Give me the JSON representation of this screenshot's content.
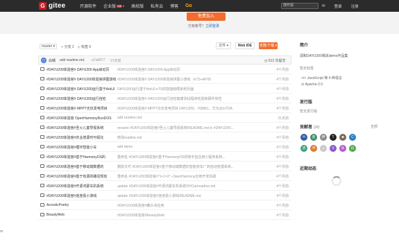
{
  "topbar": {
    "logo_letter": "G",
    "logo_text": "gitee",
    "nav": [
      {
        "label": "开源软件"
      },
      {
        "label": "企业版",
        "badge": "特惠",
        "caret": "▾"
      },
      {
        "label": "高校版"
      },
      {
        "label": "私有云"
      },
      {
        "label": "博客"
      },
      {
        "label": "Go"
      }
    ],
    "search_placeholder": "搜开源",
    "login": "登录",
    "register": "注册"
  },
  "banner": {
    "join_label": "免费加入",
    "login_tip": "已有帐号？",
    "login_link": "立即登录"
  },
  "repo_bar": {
    "branch": "master",
    "branches": "分支 2",
    "tags": "标签 0",
    "file_btn": "文件",
    "ide_btn": "Web IDE",
    "clone_btn": "克隆/下载"
  },
  "last_commit": {
    "author": "白晴",
    "message": "add readme.md.",
    "hash": "a7a8877",
    "time": "21天前",
    "count": "512 次提交"
  },
  "files": [
    {
      "name": "#DAYU200体验官# DAYU200 App启动页",
      "msg": "#DAYU200体验官# DAYU200 App启动页",
      "time": "4个月前"
    },
    {
      "name": "#DAYU200体验官# DAYU200体验官拼图游戏",
      "msg": "#DAYU200体验官# DAYU200体验官拼图小游戏（eTS+API9）",
      "time": "4个月前"
    },
    {
      "name": "#DAYU200体验官# DAYU200运行基于ArkUI",
      "msg": "DAYU200运行基于ArkUI-eTS的智能晾晒系统页面",
      "time": "4个月前"
    },
    {
      "name": "#DAYU200体验官# DAYU200运行自检",
      "msg": "#DAYU200体验官# DAYU200运行自检健康测试程序检验和硬件效性",
      "time": "4个月前"
    },
    {
      "name": "#DAYU200体验官# MPPT光伏发电项目",
      "msg": "#DAYU200体验官# MPPT光伏发电项目 DAYU200、Hi3861、华为云IoTDA",
      "time": "4个月前"
    },
    {
      "name": "#DAYU200体验官 OpenHarmonyRunDOS",
      "msg": "add readme.md.",
      "time": "21天前"
    },
    {
      "name": "#DAYU200体验官#圣火儿童导视系统",
      "msg": "rename #DAYU200体验官#圣火儿童导视系统/README.md to #DAYU200...",
      "time": "4个月前"
    },
    {
      "name": "#DAYU200体验官#农业增源时可视化",
      "msg": "修改readme.md",
      "time": "4个月前"
    },
    {
      "name": "#DAYU200体验官#循环智能小车",
      "msg": "add demo",
      "time": "4个月前"
    },
    {
      "name": "#DAYU200体验官#基于HarmonyOS的",
      "msg": "重命名 #DAYU200体验官#基于HarmonyOS的随手拍应用小程序系统...",
      "time": "4个月前"
    },
    {
      "name": "#DAYU200体验官#基于移动端数据的",
      "msg": "删除文件 #DAYU200体验官#基于移动端数据的智能校车厂商自动管理系统...",
      "time": "4个月前"
    },
    {
      "name": "#DAYU200体验官#基于有源的路径规划",
      "msg": "重命名 #DAYU200体验官#\"1+1=2\"--OpenHarmony应用开发实践",
      "time": "4个月前"
    },
    {
      "name": "#DAYU200体验官#开源鸿蒙车机系统",
      "msg": "update #DAYU200体验官#开源鸿蒙车机系统OHCar/readme.md.",
      "time": "4个月前"
    },
    {
      "name": "#DAYU200体验官#连连看小游戏",
      "msg": "update #DAYU200体验官#连连看小游戏/README.md.",
      "time": "4个月前"
    },
    {
      "name": "AcrosticPoetry",
      "msg": "#DAYU200体验官#藏头诗应用",
      "time": "4个月前"
    },
    {
      "name": "BeautyWeb",
      "msg": "#DAYU200体验官#BeautyWeb",
      "time": "4个月前"
    }
  ],
  "sidebar": {
    "intro_title": "简介",
    "intro_desc": "润和DAYU200相关demo作品集",
    "no_tags": "暂无标签",
    "lang": "JavaScript 等 4 种语言",
    "license": "Apache-2.0",
    "release_title": "发行版",
    "release_none": "暂无发行版",
    "contrib_title": "贡献者",
    "contrib_count": "(28)",
    "contrib_all": "全部",
    "activity_title": "近期动态"
  },
  "contributors": [
    {
      "initial": "H",
      "color": "#2f5f9e"
    },
    {
      "initial": "连",
      "color": "#3c8d6a"
    },
    {
      "initial": "伊",
      "color": "#8a8a8a"
    },
    {
      "initial": "T",
      "color": "#222222"
    },
    {
      "initial": "☻",
      "color": "#7a6a5a"
    },
    {
      "initial": "C",
      "color": "#2a7fc2"
    },
    {
      "initial": "浓",
      "color": "#3ea17a"
    },
    {
      "initial": "冲",
      "color": "#e07a2a"
    },
    {
      "initial": "☺",
      "color": "#c9c9c9"
    },
    {
      "initial": "X",
      "color": "#8a5ad0"
    },
    {
      "initial": "永",
      "color": "#b45ac8"
    },
    {
      "initial": "白",
      "color": "#4fa84f"
    }
  ],
  "edge_text": "rs"
}
